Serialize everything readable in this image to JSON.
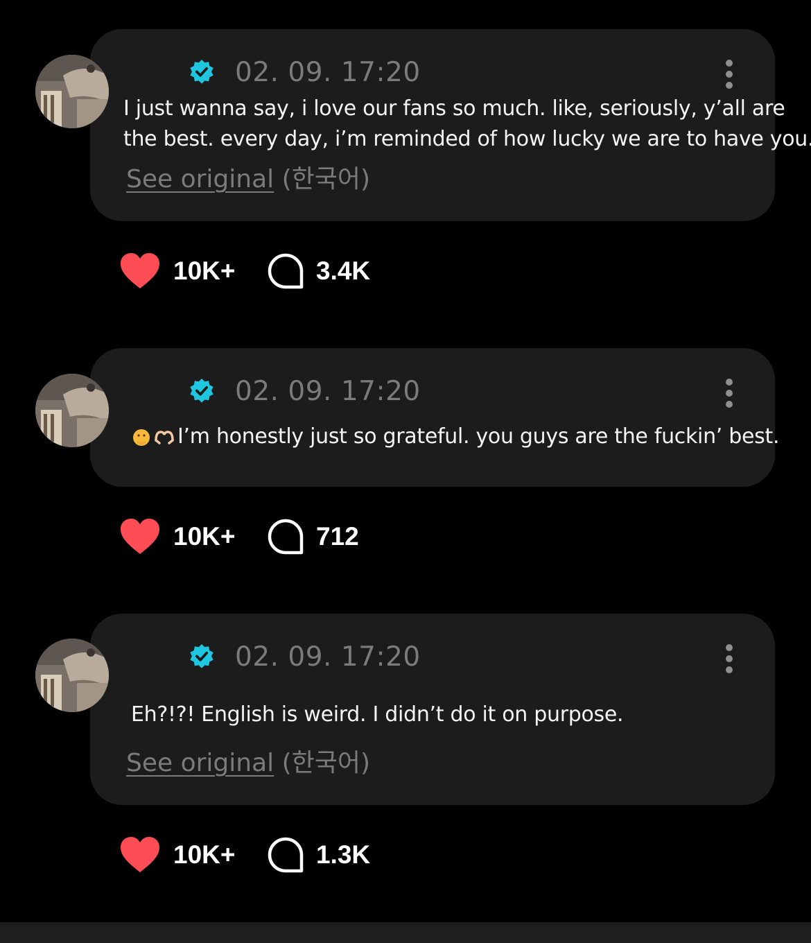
{
  "posts": [
    {
      "timestamp": "02. 09. 17:20",
      "text_lines": [
        "I just wanna say, i love our fans so much. like, seriously, y’all are",
        "the best. every day, i’m reminded of how lucky we  are to have you."
      ],
      "see_original": "See original",
      "language": "(한국어)",
      "likes": "10K+",
      "comments": "3.4K"
    },
    {
      "timestamp": "02. 09. 17:20",
      "text": "I’m honestly just so grateful. you guys are the fuckin’ best.",
      "emojis": [
        "hand-over-mouth-emoji",
        "heart-hands-emoji"
      ],
      "likes": "10K+",
      "comments": "712"
    },
    {
      "timestamp": "02. 09. 17:20",
      "text": "Eh?!?! English is weird. I didn’t do it on purpose.",
      "see_original": "See original",
      "language": "(한국어)",
      "likes": "10K+",
      "comments": "1.3K"
    }
  ],
  "icons": {
    "verified": "verified-badge-icon",
    "more": "more-vertical-icon",
    "like": "heart-icon",
    "comment": "comment-bubble-icon"
  },
  "colors": {
    "background": "#000000",
    "bubble": "#1c1c1c",
    "verified": "#1fc6e0",
    "heart": "#ff4d55",
    "timestamp": "#7b7b7b",
    "text": "#f4f4f4"
  }
}
